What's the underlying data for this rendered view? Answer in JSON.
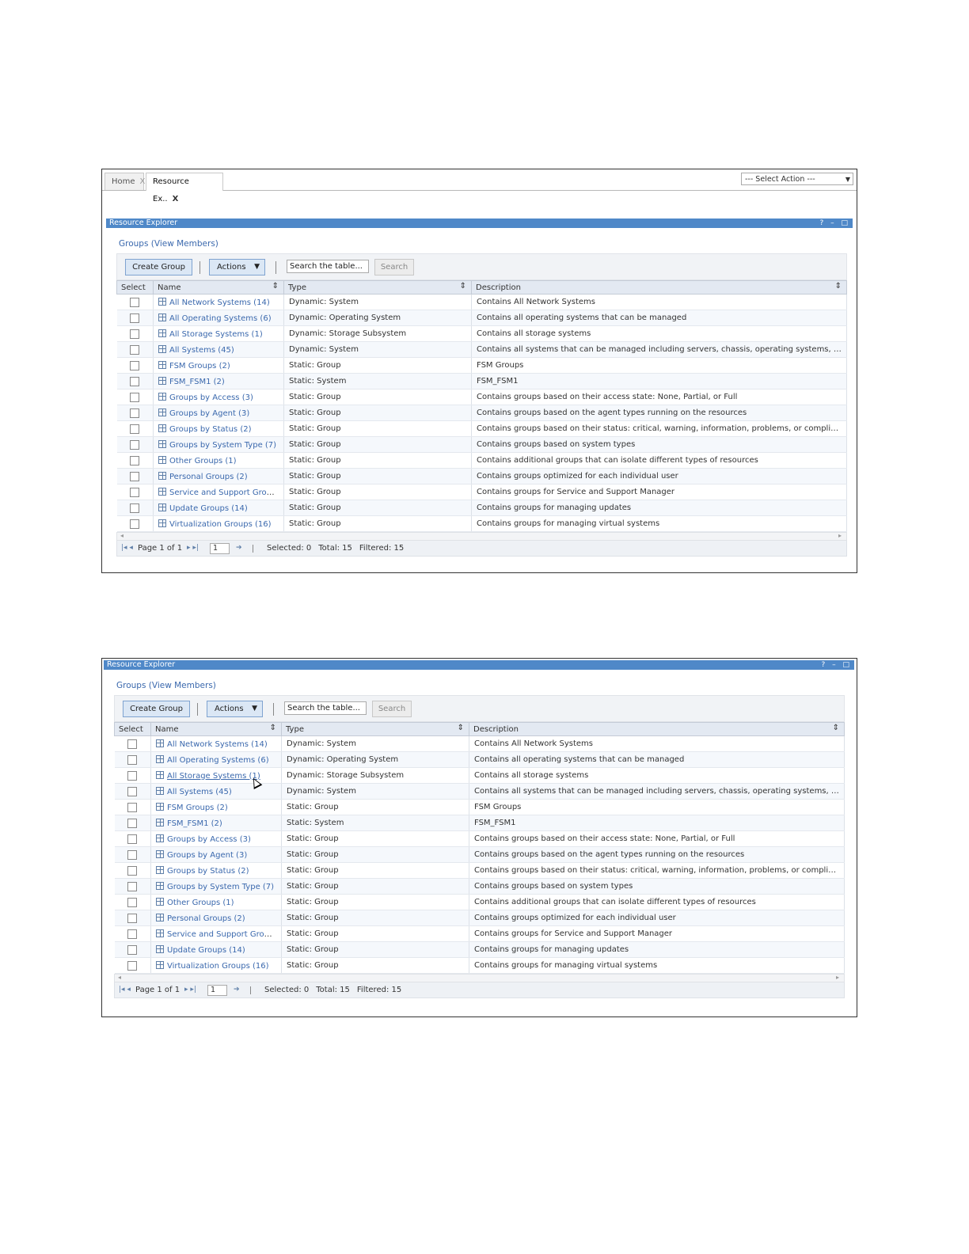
{
  "tabs": {
    "home": "Home",
    "active": "Resource Ex..",
    "close": "X"
  },
  "select_action": "--- Select Action ---",
  "portlet": {
    "title": "Resource Explorer",
    "tools": "? – □"
  },
  "groups_link": "Groups (View Members)",
  "toolbar": {
    "create_group": "Create Group",
    "actions": "Actions",
    "search_placeholder": "Search the table...",
    "search_button": "Search"
  },
  "columns": {
    "select": "Select",
    "name": "Name",
    "type": "Type",
    "description": "Description"
  },
  "rows": [
    {
      "name": "All Network Systems (14)",
      "type": "Dynamic: System",
      "description": "Contains All Network Systems"
    },
    {
      "name": "All Operating Systems (6)",
      "type": "Dynamic: Operating System",
      "description": "Contains all operating systems that can be managed"
    },
    {
      "name": "All Storage Systems (1)",
      "type": "Dynamic: Storage Subsystem",
      "description": "Contains all storage systems"
    },
    {
      "name": "All Systems (45)",
      "type": "Dynamic: System",
      "description": "Contains all systems that can be managed including servers, chassis, operating systems, s..."
    },
    {
      "name": "FSM Groups (2)",
      "type": "Static: Group",
      "description": "FSM Groups"
    },
    {
      "name": "FSM_FSM1 (2)",
      "type": "Static: System",
      "description": "FSM_FSM1"
    },
    {
      "name": "Groups by Access (3)",
      "type": "Static: Group",
      "description": "Contains groups based on their access state: None, Partial, or Full"
    },
    {
      "name": "Groups by Agent (3)",
      "type": "Static: Group",
      "description": "Contains groups based on the agent types running on the resources"
    },
    {
      "name": "Groups by Status (2)",
      "type": "Static: Group",
      "description": "Contains groups based on their status: critical, warning, information, problems, or complia..."
    },
    {
      "name": "Groups by System Type (7)",
      "type": "Static: Group",
      "description": "Contains groups based on system types"
    },
    {
      "name": "Other Groups (1)",
      "type": "Static: Group",
      "description": "Contains additional groups that can isolate different types of resources"
    },
    {
      "name": "Personal Groups (2)",
      "type": "Static: Group",
      "description": "Contains groups optimized for each individual user"
    },
    {
      "name": "Service and Support Group...",
      "type": "Static: Group",
      "description": "Contains groups for Service and Support Manager"
    },
    {
      "name": "Update Groups (14)",
      "type": "Static: Group",
      "description": "Contains groups for managing updates"
    },
    {
      "name": "Virtualization Groups (16)",
      "type": "Static: Group",
      "description": "Contains groups for managing virtual systems"
    }
  ],
  "pager": {
    "page_label": "Page 1 of 1",
    "page_input": "1",
    "selected": "Selected: 0",
    "total": "Total: 15",
    "filtered": "Filtered: 15"
  },
  "colors": {
    "titlebar": "#4f88c8",
    "link": "#3a68ad",
    "header_bg": "#e3e9f2"
  },
  "icons": [
    "close-icon",
    "dropdown-arrow-icon",
    "sort-icon",
    "group-table-icon",
    "first-page-icon",
    "prev-page-icon",
    "next-page-icon",
    "last-page-icon",
    "go-icon",
    "mouse-cursor-icon"
  ]
}
